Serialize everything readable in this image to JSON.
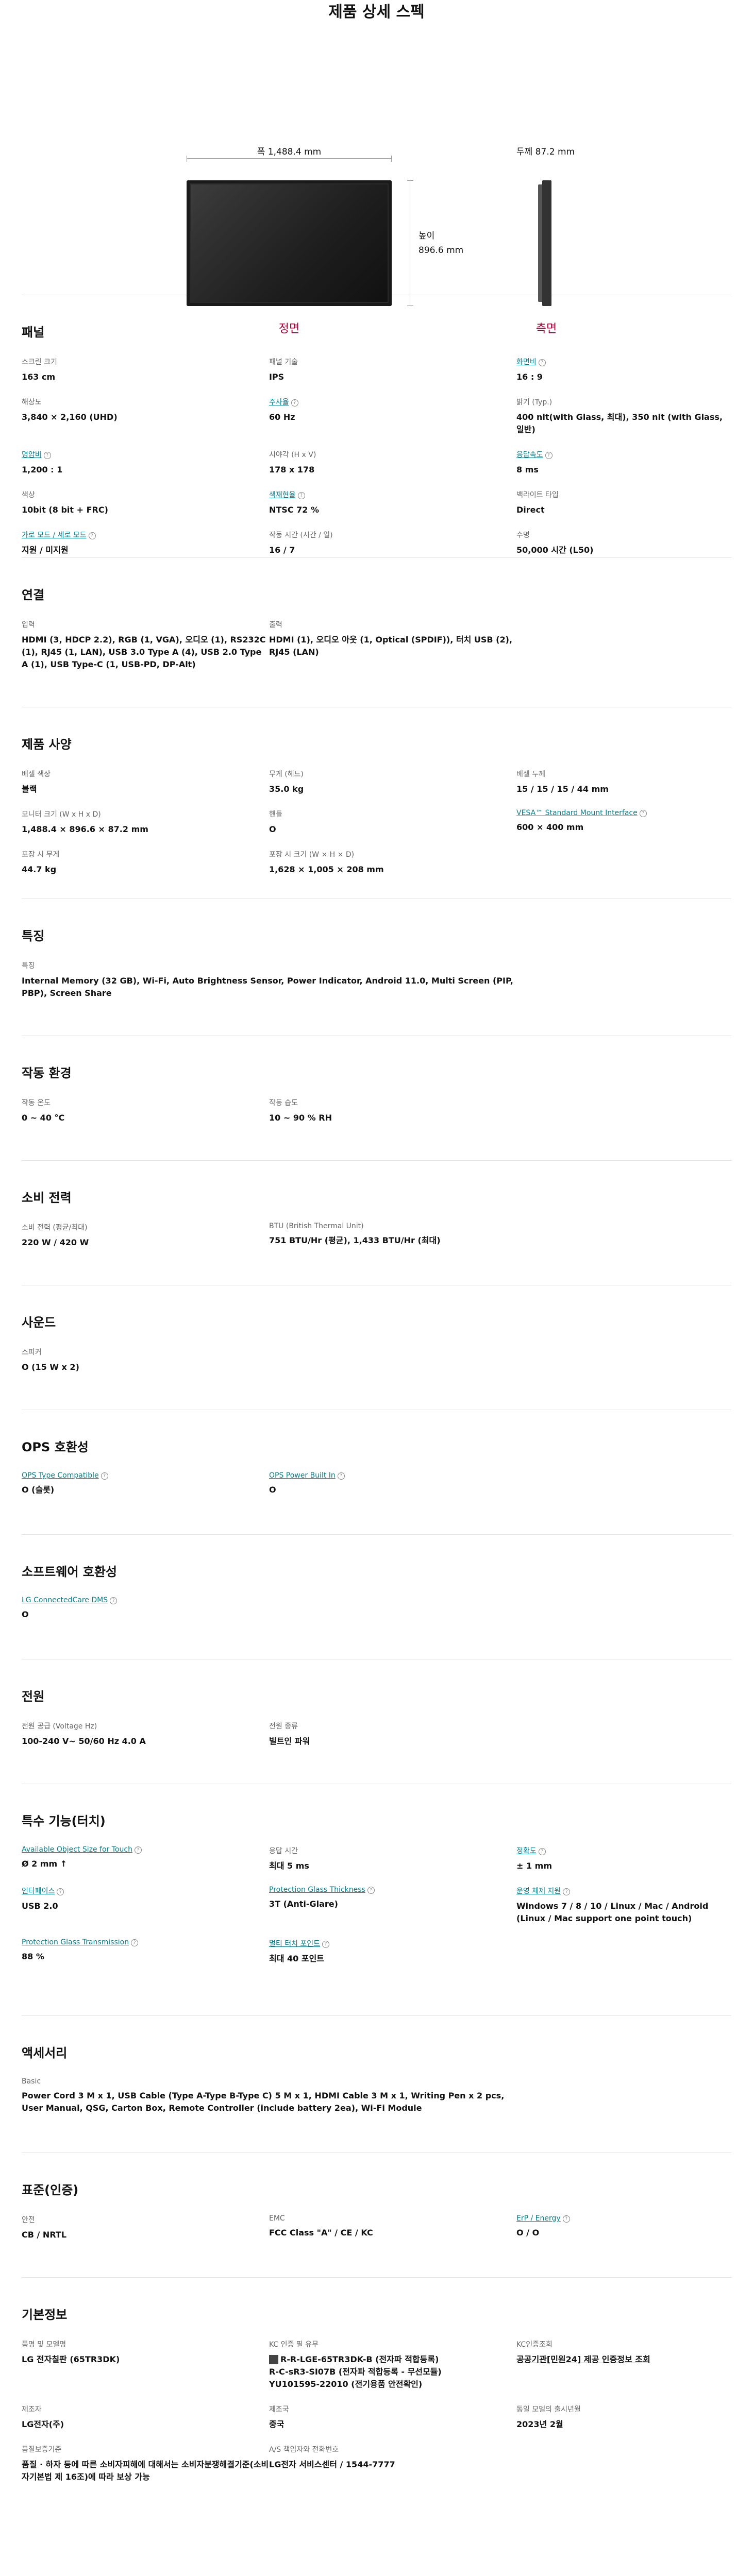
{
  "title": "제품 상세 스펙",
  "dimensions": {
    "width_label": "폭 1,488.4 mm",
    "height_label_1": "높이",
    "height_label_2": "896.6 mm",
    "depth_label": "두께 87.2 mm",
    "front_label": "정면",
    "side_label": "측면"
  },
  "sections": [
    {
      "id": "panel",
      "title": "패널",
      "items": [
        {
          "k": "스크린 크기",
          "v": "163 cm"
        },
        {
          "k": "패널 기술",
          "v": "IPS"
        },
        {
          "k": "화면비",
          "v": "16 : 9",
          "link": true
        },
        {
          "k": "해상도",
          "v": "3,840 × 2,160 (UHD)"
        },
        {
          "k": "주사율",
          "v": "60 Hz",
          "link": true
        },
        {
          "k": "밝기 (Typ.)",
          "v": "400 nit(with Glass, 최대), 350 nit (with Glass, 일반)"
        },
        {
          "k": "명암비",
          "v": "1,200 : 1",
          "link": true
        },
        {
          "k": "시야각 (H x V)",
          "v": "178 x 178"
        },
        {
          "k": "응답속도",
          "v": "8 ms",
          "link": true
        },
        {
          "k": "색상",
          "v": "10bit (8 bit + FRC)"
        },
        {
          "k": "색재현율",
          "v": "NTSC 72 %",
          "link": true
        },
        {
          "k": "백라이트 타입",
          "v": "Direct"
        },
        {
          "k": "가로 모드 / 세로 모드",
          "v": "지원 / 미지원",
          "link": true
        },
        {
          "k": "작동 시간 (시간 / 일)",
          "v": "16 / 7"
        },
        {
          "k": "수명",
          "v": "50,000 시간 (L50)"
        }
      ]
    },
    {
      "id": "connect",
      "title": "연결",
      "items": [
        {
          "k": "입력",
          "v": "HDMI (3, HDCP 2.2), RGB (1, VGA), 오디오 (1), RS232C (1), RJ45 (1, LAN), USB 3.0 Type A (4), USB 2.0 Type A (1), USB Type-C (1, USB-PD, DP-Alt)"
        },
        {
          "k": "출력",
          "v": "HDMI (1), 오디오 아웃 (1, Optical (SPDIF)), 터치 USB (2), RJ45 (LAN)"
        }
      ]
    },
    {
      "id": "spec",
      "title": "제품 사양",
      "items": [
        {
          "k": "베젤 색상",
          "v": "블랙"
        },
        {
          "k": "무게 (헤드)",
          "v": "35.0 kg"
        },
        {
          "k": "베젤 두께",
          "v": "15 / 15 / 15 / 44 mm"
        },
        {
          "k": "모니터 크기 (W x H x D)",
          "v": "1,488.4 × 896.6 × 87.2 mm"
        },
        {
          "k": "핸들",
          "v": "O"
        },
        {
          "k": "VESA™ Standard Mount Interface",
          "v": "600 × 400 mm",
          "link": true
        },
        {
          "k": "포장 시 무게",
          "v": "44.7 kg"
        },
        {
          "k": "포장 시 크기 (W × H × D)",
          "v": "1,628 × 1,005 × 208 mm"
        }
      ]
    },
    {
      "id": "feature",
      "title": "특징",
      "items": [
        {
          "k": "특징",
          "v": "Internal Memory (32 GB), Wi-Fi, Auto Brightness Sensor, Power Indicator, Android 11.0, Multi Screen (PIP, PBP), Screen Share",
          "span": 2
        }
      ]
    },
    {
      "id": "env",
      "title": "작동 환경",
      "items": [
        {
          "k": "작동 온도",
          "v": "0 ~ 40 °C"
        },
        {
          "k": "작동 습도",
          "v": "10 ~ 90 % RH"
        }
      ]
    },
    {
      "id": "power",
      "title": "소비 전력",
      "items": [
        {
          "k": "소비 전력 (평균/최대)",
          "v": "220 W / 420 W"
        },
        {
          "k": "BTU (British Thermal Unit)",
          "v": "751 BTU/Hr (평균), 1,433 BTU/Hr (최대)"
        }
      ]
    },
    {
      "id": "sound",
      "title": "사운드",
      "items": [
        {
          "k": "스피커",
          "v": "O (15 W x 2)"
        }
      ]
    },
    {
      "id": "ops",
      "title": "OPS 호환성",
      "items": [
        {
          "k": "OPS Type Compatible",
          "v": "O (슬롯)",
          "link": true
        },
        {
          "k": "OPS Power Built In",
          "v": "O",
          "link": true
        }
      ]
    },
    {
      "id": "sw",
      "title": "소프트웨어 호환성",
      "items": [
        {
          "k": "LG ConnectedCare DMS",
          "v": "O",
          "link": true
        }
      ]
    },
    {
      "id": "psu",
      "title": "전원",
      "items": [
        {
          "k": "전원 공급 (Voltage Hz)",
          "v": "100-240 V~ 50/60 Hz 4.0 A"
        },
        {
          "k": "전원 종류",
          "v": "빌트인 파워"
        }
      ]
    },
    {
      "id": "touch",
      "title": "특수 기능(터치)",
      "items": [
        {
          "k": "Available Object Size for Touch",
          "v": "Ø 2 mm ↑",
          "link": true
        },
        {
          "k": "응답 시간",
          "v": "최대 5 ms"
        },
        {
          "k": "정확도",
          "v": "± 1 mm",
          "link": true
        },
        {
          "k": "인터페이스",
          "v": "USB 2.0",
          "link": true
        },
        {
          "k": "Protection Glass Thickness",
          "v": "3T (Anti-Glare)",
          "link": true
        },
        {
          "k": "운영 체제 지원",
          "v": "Windows 7 / 8 / 10 / Linux / Mac / Android (Linux / Mac support one point touch)",
          "link": true
        },
        {
          "k": "Protection Glass Transmission",
          "v": "88 %",
          "link": true
        },
        {
          "k": "멀티 터치 포인트",
          "v": "최대 40 포인트",
          "link": true
        }
      ]
    },
    {
      "id": "acc",
      "title": "액세서리",
      "items": [
        {
          "k": "Basic",
          "v": "Power Cord 3 M x 1, USB Cable (Type A-Type B-Type C) 5 M x 1, HDMI Cable 3 M x 1, Writing Pen x 2 pcs, User Manual, QSG, Carton Box, Remote Controller (include battery 2ea), Wi-Fi Module",
          "span": 2
        }
      ]
    },
    {
      "id": "cert",
      "title": "표준(인증)",
      "items": [
        {
          "k": "안전",
          "v": "CB / NRTL"
        },
        {
          "k": "EMC",
          "v": "FCC Class \"A\" / CE / KC"
        },
        {
          "k": "ErP / Energy",
          "v": "O / O",
          "link": true
        }
      ]
    },
    {
      "id": "basic",
      "title": "기본정보",
      "items": [
        {
          "k": "품명 및 모델명",
          "v": "LG 전자칠판 (65TR3DK)"
        },
        {
          "k": "KC 인증 필 유무",
          "v": "R-R-LGE-65TR3DK-B (전자파 적합등록)\nR-C-sR3-SI07B (전자파 적합등록 - 무선모듈)\nYU101595-22010 (전기용품 안전확인)",
          "icon": true
        },
        {
          "k": "KC인증조회",
          "v": "공공기관[민원24] 제공 인증정보 조회",
          "ulink": true
        },
        {
          "k": "제조자",
          "v": "LG전자(주)"
        },
        {
          "k": "제조국",
          "v": "중국"
        },
        {
          "k": "동일 모델의 출시년월",
          "v": "2023년 2월"
        },
        {
          "k": "품질보증기준",
          "v": "품질 · 하자 등에 따른 소비자피해에 대해서는 소비자분쟁해결기준(소비자기본법 제 16조)에 따라 보상 가능"
        },
        {
          "k": "A/S 책임자와 전화번호",
          "v": "LG전자 서비스센터 / 1544-7777"
        }
      ]
    }
  ]
}
